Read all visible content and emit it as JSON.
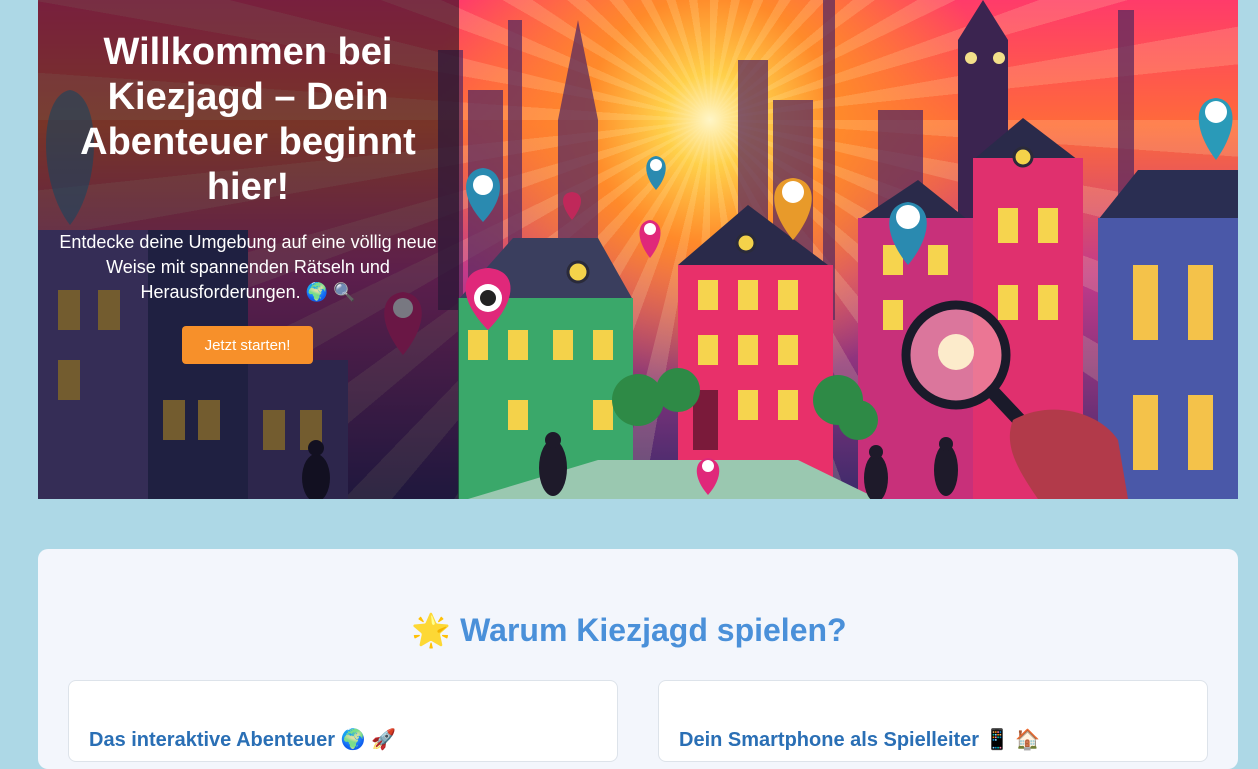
{
  "hero": {
    "title": "Willkommen bei Kiezjagd – Dein Abenteuer beginnt hier!",
    "subtitle": "Entdecke deine Umgebung auf eine völlig neue Weise mit spannenden Rätseln und Herausforderungen. 🌍 🔍",
    "cta_label": "Jetzt starten!"
  },
  "features": {
    "title": "🌟 Warum Kiezjagd spielen?",
    "cards": [
      {
        "title": "Das interaktive Abenteuer 🌍 🚀"
      },
      {
        "title": "Dein Smartphone als Spielleiter 📱 🏠"
      }
    ]
  },
  "colors": {
    "page_background": "#add8e6",
    "cta": "#f7902a",
    "features_heading": "#4a90d9",
    "card_heading": "#2a6fb5"
  }
}
